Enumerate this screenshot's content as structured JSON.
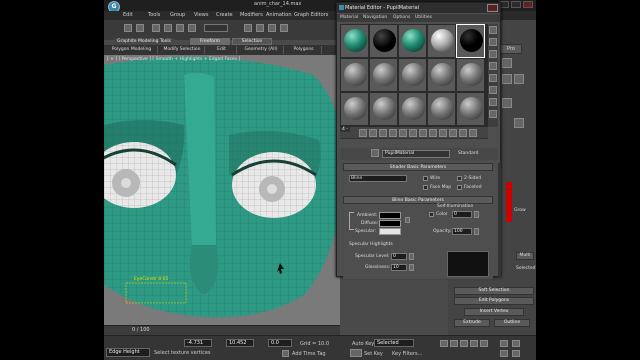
{
  "window": {
    "title": "anim_char_14.max"
  },
  "menubar": {
    "items": [
      "Edit",
      "Tools",
      "Group",
      "Views",
      "Create",
      "Modifiers",
      "Animation",
      "Graph Editors"
    ]
  },
  "ribbon": {
    "title": "Graphite Modeling Tools",
    "tabs": [
      "Freeform",
      "Selection"
    ],
    "buttons": [
      "Polygon Modeling",
      "Modify Selection",
      "Edit",
      "Geometry (All)",
      "Polygons"
    ]
  },
  "viewport": {
    "label": "[ + ] [ Perspective ] [ Smooth + Highlights + Edged Faces ]",
    "edge_label": "EyeConstr 0.65",
    "face_color": "#2e9a84",
    "background": "#7a7a7a"
  },
  "timeline": {
    "frame": "0 / 100"
  },
  "statusbar": {
    "edge_height_label": "Edge Height",
    "selected_text": "Select texture vertices",
    "x_value": "-4.731",
    "y_value": "10.452",
    "z_value": "0.0",
    "grid": "Grid = 10.0",
    "add_time_tag": "Add Time Tag",
    "auto_key": "Auto Key",
    "set_key": "Set Key",
    "selected": "Selected",
    "key_filters": "Key Filters..."
  },
  "material_editor": {
    "title": "Material Editor - PupilMaterial",
    "menus": [
      "Material",
      "Navigation",
      "Options",
      "Utilities"
    ],
    "slot_name": "4 -",
    "material_name": "PupilMaterial",
    "material_type": "Standard",
    "shader_rollout": "Shader Basic Parameters",
    "shader": "Blinn",
    "shader_options": [
      "Wire",
      "2-Sided",
      "Face Map",
      "Faceted"
    ],
    "blinn_rollout": "Blinn Basic Parameters",
    "self_illumination": "Self-Illumination",
    "color_label": "Color",
    "color_value": "0",
    "ambient_label": "Ambient:",
    "diffuse_label": "Diffuse:",
    "specular_label": "Specular:",
    "opacity_label": "Opacity:",
    "opacity_value": "100",
    "specular_highlights": "Specular Highlights",
    "specular_level_label": "Specular Level:",
    "specular_level_value": "0",
    "glossiness_label": "Glossiness:",
    "glossiness_value": "10",
    "ambient_color": "#000000",
    "diffuse_color": "#000000",
    "specular_color": "#e6e6e6"
  },
  "command_panel": {
    "pro_label": "Pro",
    "soft_selection": "Soft Selection",
    "edit_polygons": "Edit Polygons",
    "insert_vertex": "Insert Vertex",
    "extrude": "Extrude",
    "outline": "Outline",
    "selected": "Selected",
    "multi": "Multi",
    "grow": "Grow"
  }
}
